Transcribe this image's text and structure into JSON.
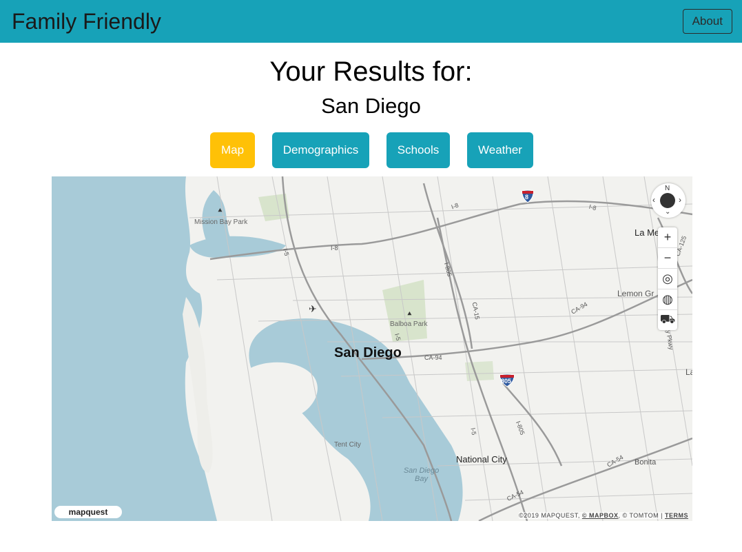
{
  "navbar": {
    "brand": "Family Friendly",
    "about_label": "About"
  },
  "header": {
    "title": "Your Results for:",
    "city": "San Diego"
  },
  "tabs": [
    {
      "label": "Map",
      "active": true
    },
    {
      "label": "Demographics",
      "active": false
    },
    {
      "label": "Schools",
      "active": false
    },
    {
      "label": "Weather",
      "active": false
    }
  ],
  "colors": {
    "navbar": "#17a2b8",
    "active_tab": "#ffc107",
    "tab": "#17a2b8",
    "water": "#a8cbd8"
  },
  "map": {
    "labels": {
      "city": "San Diego",
      "mission_bay": "Mission Bay Park",
      "balboa": "Balboa Park",
      "tent_city": "Tent City",
      "bay": "San Diego Bay",
      "national_city": "National City",
      "bonita": "Bonita",
      "la_mesa": "La Me",
      "lemon_grove": "Lemon Gr",
      "la": "La"
    },
    "roads": [
      "I-8",
      "I-8",
      "I-8",
      "I-5",
      "I-5",
      "I-5",
      "I-805",
      "I-805",
      "CA-15",
      "CA-94",
      "CA-94",
      "CA-54",
      "CA-54",
      "CA-125",
      "ay Pkwy"
    ],
    "shields": [
      "8",
      "805"
    ],
    "compass_label": "N",
    "controls": [
      "+",
      "−",
      "locate",
      "globe",
      "traffic"
    ],
    "attribution": {
      "prefix": "©2019 MAPQUEST,",
      "mapbox": "© MAPBOX",
      "tomtom": ", © TOMTOM |",
      "terms": "TERMS"
    },
    "logo": "mapquest"
  }
}
